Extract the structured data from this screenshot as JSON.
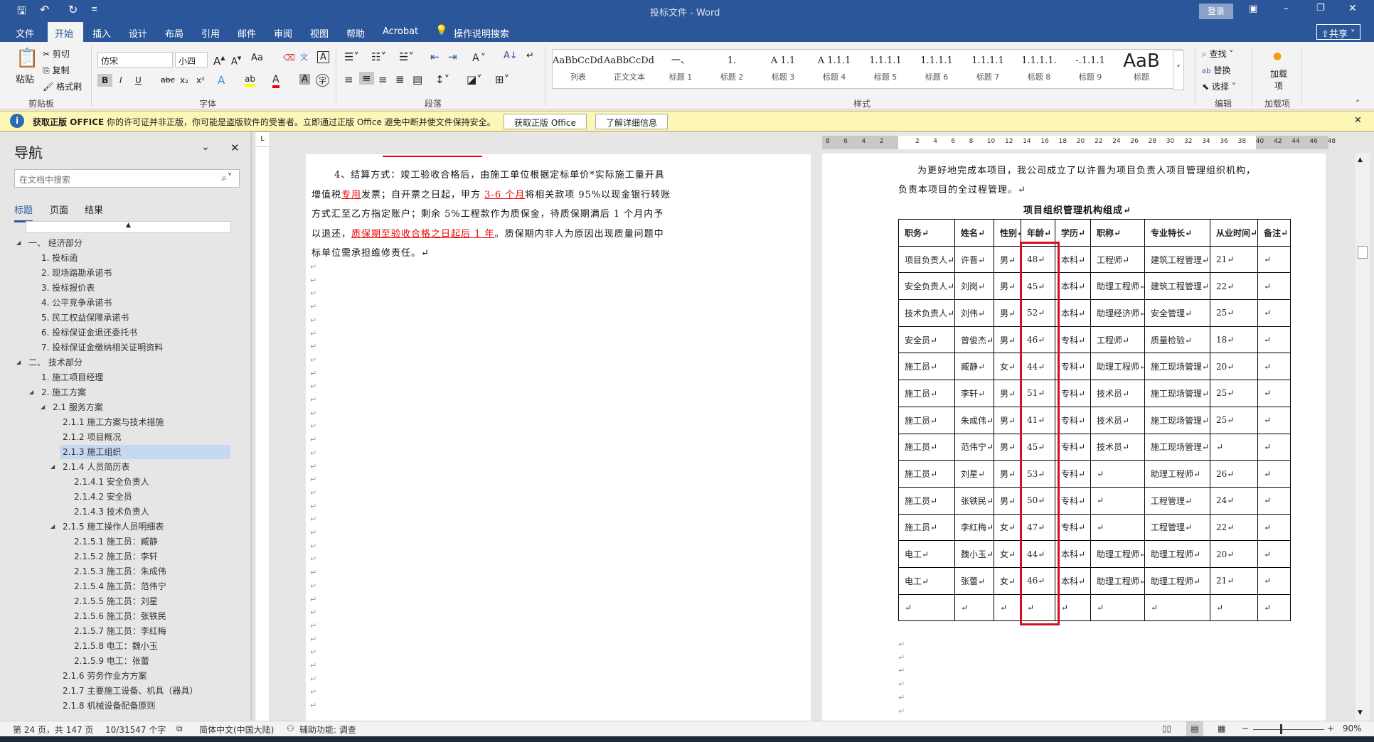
{
  "window": {
    "title": "投标文件  -  Word",
    "login": "登录",
    "share": "共享"
  },
  "quick_access": {
    "save": "save-icon",
    "undo": "undo-icon",
    "redo": "redo-icon"
  },
  "tabs": [
    {
      "label": "文件"
    },
    {
      "label": "开始",
      "active": true
    },
    {
      "label": "插入"
    },
    {
      "label": "设计"
    },
    {
      "label": "布局"
    },
    {
      "label": "引用"
    },
    {
      "label": "邮件"
    },
    {
      "label": "审阅"
    },
    {
      "label": "视图"
    },
    {
      "label": "帮助"
    },
    {
      "label": "Acrobat"
    },
    {
      "label": "操作说明搜索"
    }
  ],
  "ribbon": {
    "clipboard": {
      "label": "剪贴板",
      "paste": "粘贴",
      "cut": "剪切",
      "copy": "复制",
      "format_painter": "格式刷"
    },
    "font": {
      "label": "字体",
      "font_name": "仿宋",
      "font_size": "小四",
      "bold": "B",
      "italic": "I",
      "underline": "U",
      "strike": "abc",
      "sub": "x₂",
      "sup": "x²",
      "case": "Aa"
    },
    "paragraph": {
      "label": "段落"
    },
    "styles": {
      "label": "样式",
      "items": [
        {
          "sample": "AaBbCcDdI",
          "name": "列表"
        },
        {
          "sample": "AaBbCcDdI",
          "name": "正文文本"
        },
        {
          "sample": "一、",
          "name": "标题 1"
        },
        {
          "sample": "1.",
          "name": "标题 2"
        },
        {
          "sample": "A 1.1",
          "name": "标题 3"
        },
        {
          "sample": "A 1.1.1",
          "name": "标题 4"
        },
        {
          "sample": "1.1.1.1",
          "name": "标题 5"
        },
        {
          "sample": "1.1.1.1",
          "name": "标题 6"
        },
        {
          "sample": "1.1.1.1",
          "name": "标题 7"
        },
        {
          "sample": "1.1.1.1.",
          "name": "标题 8"
        },
        {
          "sample": "-.1.1.1",
          "name": "标题 9"
        },
        {
          "sample": "AaB",
          "name": "标题"
        }
      ]
    },
    "editing": {
      "label": "编辑",
      "find": "查找",
      "replace": "替换",
      "select": "选择"
    },
    "addins": {
      "label": "加载项",
      "button": "加载项"
    }
  },
  "message_bar": {
    "title": "获取正版 OFFICE",
    "text": "你的许可证并非正版，你可能是盗版软件的受害者。立即通过正版 Office 避免中断并使文件保持安全。",
    "btn1": "获取正版 Office",
    "btn2": "了解详细信息"
  },
  "nav": {
    "title": "导航",
    "search_placeholder": "在文档中搜索",
    "tabs": [
      "标题",
      "页面",
      "结果"
    ],
    "items": [
      {
        "t": "一、  经济部分",
        "l": 0,
        "exp": true
      },
      {
        "t": "1. 投标函",
        "l": 1
      },
      {
        "t": "2. 现场踏勘承诺书",
        "l": 1
      },
      {
        "t": "3. 投标报价表",
        "l": 1
      },
      {
        "t": "4. 公平竞争承诺书",
        "l": 1
      },
      {
        "t": "5. 民工权益保障承诺书",
        "l": 1
      },
      {
        "t": "6. 投标保证金退还委托书",
        "l": 1
      },
      {
        "t": "7. 投标保证金缴纳相关证明资料",
        "l": 1
      },
      {
        "t": "二、  技术部分",
        "l": 0,
        "exp": true
      },
      {
        "t": "1. 施工项目经理",
        "l": 1
      },
      {
        "t": "2. 施工方案",
        "l": 1,
        "exp": true
      },
      {
        "t": "2.1 服务方案",
        "l": 2,
        "exp": true
      },
      {
        "t": "2.1.1 施工方案与技术措施",
        "l": 3
      },
      {
        "t": "2.1.2 项目概况",
        "l": 3
      },
      {
        "t": "2.1.3 施工组织",
        "l": 3,
        "sel": true
      },
      {
        "t": "2.1.4 人员简历表",
        "l": 3,
        "exp": true
      },
      {
        "t": "2.1.4.1 安全负责人",
        "l": 4
      },
      {
        "t": "2.1.4.2 安全员",
        "l": 4
      },
      {
        "t": "2.1.4.3 技术负责人",
        "l": 4
      },
      {
        "t": "2.1.5 施工操作人员明细表",
        "l": 3,
        "exp": true
      },
      {
        "t": "2.1.5.1 施工员：臧静",
        "l": 4
      },
      {
        "t": "2.1.5.2 施工员：李轩",
        "l": 4
      },
      {
        "t": "2.1.5.3 施工员：朱成伟",
        "l": 4
      },
      {
        "t": "2.1.5.4 施工员：范伟宁",
        "l": 4
      },
      {
        "t": "2.1.5.5 施工员：刘星",
        "l": 4
      },
      {
        "t": "2.1.5.6 施工员：张铁民",
        "l": 4
      },
      {
        "t": "2.1.5.7 施工员：李红梅",
        "l": 4
      },
      {
        "t": "2.1.5.8 电工：魏小玉",
        "l": 4
      },
      {
        "t": "2.1.5.9 电工：张蕾",
        "l": 4
      },
      {
        "t": "2.1.6 劳务作业方方案",
        "l": 3
      },
      {
        "t": "2.1.7 主要施工设备、机具（器具）",
        "l": 3
      },
      {
        "t": "2.1.8 机械设备配备原则",
        "l": 3
      }
    ]
  },
  "left_page": {
    "lines": [
      [
        {
          "t": "4、结算方式：竣工验收合格后，由施工单位根据定标单价*实际施工量开具"
        }
      ],
      [
        {
          "t": "增值税"
        },
        {
          "t": "专用",
          "red": true
        },
        {
          "t": "发票；自开票之日起，甲方 "
        },
        {
          "t": "3-6 个月",
          "red": true
        },
        {
          "t": "将相关款项 95%以现金银行转账"
        }
      ],
      [
        {
          "t": "方式汇至乙方指定账户；剩余 5%工程款作为质保金，待质保期满后 1 个月内予"
        }
      ],
      [
        {
          "t": "以退还，"
        },
        {
          "t": "质保期至验收合格之日起后 1 年",
          "red": true
        },
        {
          "t": "。质保期内非人为原因出现质量问题中"
        }
      ],
      [
        {
          "t": "标单位需承担维修责任。↵"
        }
      ]
    ]
  },
  "right_page": {
    "intro": [
      "为更好地完成本项目，我公司成立了以许晋为项目负责人项目管理组织机构，",
      "负责本项目的全过程管理。↵"
    ],
    "ruler_ticks": [
      "8",
      "6",
      "4",
      "2",
      "",
      "2",
      "4",
      "6",
      "8",
      "10",
      "12",
      "14",
      "16",
      "18",
      "20",
      "22",
      "24",
      "26",
      "28",
      "30",
      "32",
      "34",
      "36",
      "38",
      "40",
      "42",
      "44",
      "46",
      "48"
    ],
    "table_title": "项目组织管理机构组成↵",
    "headers": [
      "职务↵",
      "姓名↵",
      "性别↵",
      "年龄↵",
      "学历↵",
      "职称↵",
      "专业特长↵",
      "从业时间↵",
      "备注↵"
    ],
    "rows": [
      [
        "项目负责人↵",
        "许晋↵",
        "男↵",
        "48↵",
        "本科↵",
        "工程师↵",
        "建筑工程管理↵",
        "21↵",
        "↵"
      ],
      [
        "安全负责人↵",
        "刘岗↵",
        "男↵",
        "45↵",
        "本科↵",
        "助理工程师↵",
        "建筑工程管理↵",
        "22↵",
        "↵"
      ],
      [
        "技术负责人↵",
        "刘伟↵",
        "男↵",
        "52↵",
        "本科↵",
        "助理经济师↵",
        "安全管理↵",
        "25↵",
        "↵"
      ],
      [
        "安全员↵",
        "曾俊杰↵",
        "男↵",
        "46↵",
        "专科↵",
        "工程师↵",
        "质量检验↵",
        "18↵",
        "↵"
      ],
      [
        "施工员↵",
        "臧静↵",
        "女↵",
        "44↵",
        "专科↵",
        "助理工程师↵",
        "施工现场管理↵",
        "20↵",
        "↵"
      ],
      [
        "施工员↵",
        "李轩↵",
        "男↵",
        "51↵",
        "专科↵",
        "技术员↵",
        "施工现场管理↵",
        "25↵",
        "↵"
      ],
      [
        "施工员↵",
        "朱成伟↵",
        "男↵",
        "41↵",
        "专科↵",
        "技术员↵",
        "施工现场管理↵",
        "25↵",
        "↵"
      ],
      [
        "施工员↵",
        "范伟宁↵",
        "男↵",
        "45↵",
        "专科↵",
        "技术员↵",
        "施工现场管理↵",
        "↵",
        "↵"
      ],
      [
        "施工员↵",
        "刘星↵",
        "男↵",
        "53↵",
        "专科↵",
        "↵",
        "助理工程师↵",
        "26↵",
        "↵"
      ],
      [
        "施工员↵",
        "张铁民↵",
        "男↵",
        "50↵",
        "专科↵",
        "↵",
        "工程管理↵",
        "24↵",
        "↵"
      ],
      [
        "施工员↵",
        "李红梅↵",
        "女↵",
        "47↵",
        "专科↵",
        "↵",
        "工程管理↵",
        "22↵",
        "↵"
      ],
      [
        "电工↵",
        "魏小玉↵",
        "女↵",
        "44↵",
        "本科↵",
        "助理工程师↵",
        "助理工程师↵",
        "20↵",
        "↵"
      ],
      [
        "电工↵",
        "张蕾↵",
        "女↵",
        "46↵",
        "本科↵",
        "助理工程师↵",
        "助理工程师↵",
        "21↵",
        "↵"
      ],
      [
        "↵",
        "↵",
        "↵",
        "↵",
        "↵",
        "↵",
        "↵",
        "↵",
        "↵"
      ]
    ],
    "highlight_color": "#d01020"
  },
  "status": {
    "page": "第 24 页，共 147 页",
    "words": "10/31547 个字",
    "language": "简体中文(中国大陆)",
    "accessibility": "辅助功能: 调查",
    "zoom": "90%"
  }
}
